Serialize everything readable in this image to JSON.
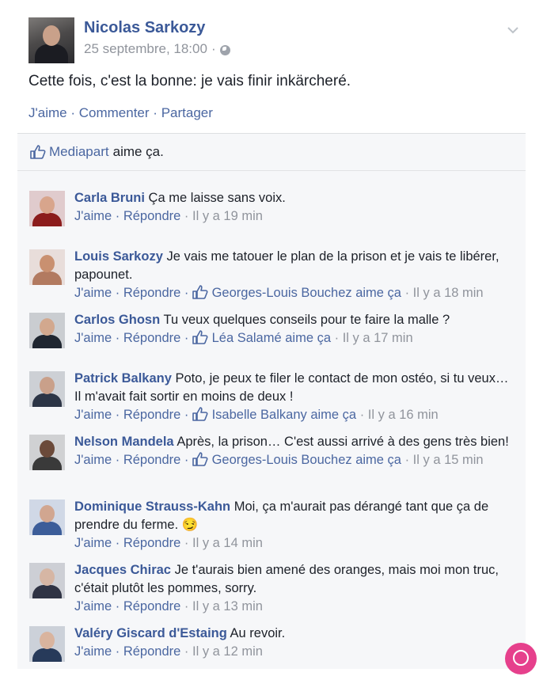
{
  "post": {
    "author": "Nicolas Sarkozy",
    "date": "25 septembre, 18:00",
    "separator": "·",
    "text": "Cette fois, c'est la bonne: je vais finir inkärcheré.",
    "actions": {
      "like": "J'aime",
      "comment": "Commenter",
      "share": "Partager",
      "sep": "·"
    }
  },
  "likes": {
    "page": "Mediapart",
    "text": "aime ça."
  },
  "comments": [
    {
      "author": "Carla Bruni",
      "text": "Ça me laisse sans voix.",
      "like": "J'aime",
      "reply": "Répondre",
      "liked_by": "",
      "time": "Il y a 19 min"
    },
    {
      "author": "Louis Sarkozy",
      "text": "Je vais me tatouer le plan de la prison et je vais te libérer, papounet.",
      "like": "J'aime",
      "reply": "Répondre",
      "liked_by": "Georges-Louis Bouchez aime ça",
      "time": "Il y a 18 min"
    },
    {
      "author": "Carlos Ghosn",
      "text": "Tu veux quelques conseils pour te faire la malle ?",
      "like": "J'aime",
      "reply": "Répondre",
      "liked_by": "Léa Salamé aime ça",
      "time": "Il y a 17 min"
    },
    {
      "author": "Patrick Balkany",
      "text": "Poto, je peux te filer le contact de mon ostéo, si tu veux… Il m'avait fait sortir en moins de deux !",
      "like": "J'aime",
      "reply": "Répondre",
      "liked_by": "Isabelle Balkany aime ça",
      "time": "Il y a 16 min"
    },
    {
      "author": "Nelson Mandela",
      "text": "Après, la prison… C'est aussi arrivé à des gens très bien!",
      "like": "J'aime",
      "reply": "Répondre",
      "liked_by": "Georges-Louis Bouchez aime ça",
      "time": "Il y a 15 min"
    },
    {
      "author": "Dominique Strauss-Kahn",
      "text": "Moi, ça m'aurait pas dérangé tant que ça de prendre du ferme. 😏",
      "like": "J'aime",
      "reply": "Répondre",
      "liked_by": "",
      "time": "Il y a 14 min"
    },
    {
      "author": "Jacques Chirac",
      "text": "Je t'aurais bien amené des oranges, mais moi mon truc, c'était plutôt les pommes, sorry.",
      "like": "J'aime",
      "reply": "Répondre",
      "liked_by": "",
      "time": "Il y a 13 min"
    },
    {
      "author": "Valéry Giscard d'Estaing",
      "text": "Au revoir.",
      "like": "J'aime",
      "reply": "Répondre",
      "liked_by": "",
      "time": "Il y a 12 min"
    }
  ],
  "icons": {
    "like": "thumbs-up-icon",
    "menu": "chevron-down-icon",
    "privacy": "globe-icon"
  },
  "colors": {
    "link": "#4b67a1",
    "name": "#3b5998",
    "muted": "#90949c",
    "panel": "#f6f7f9"
  }
}
